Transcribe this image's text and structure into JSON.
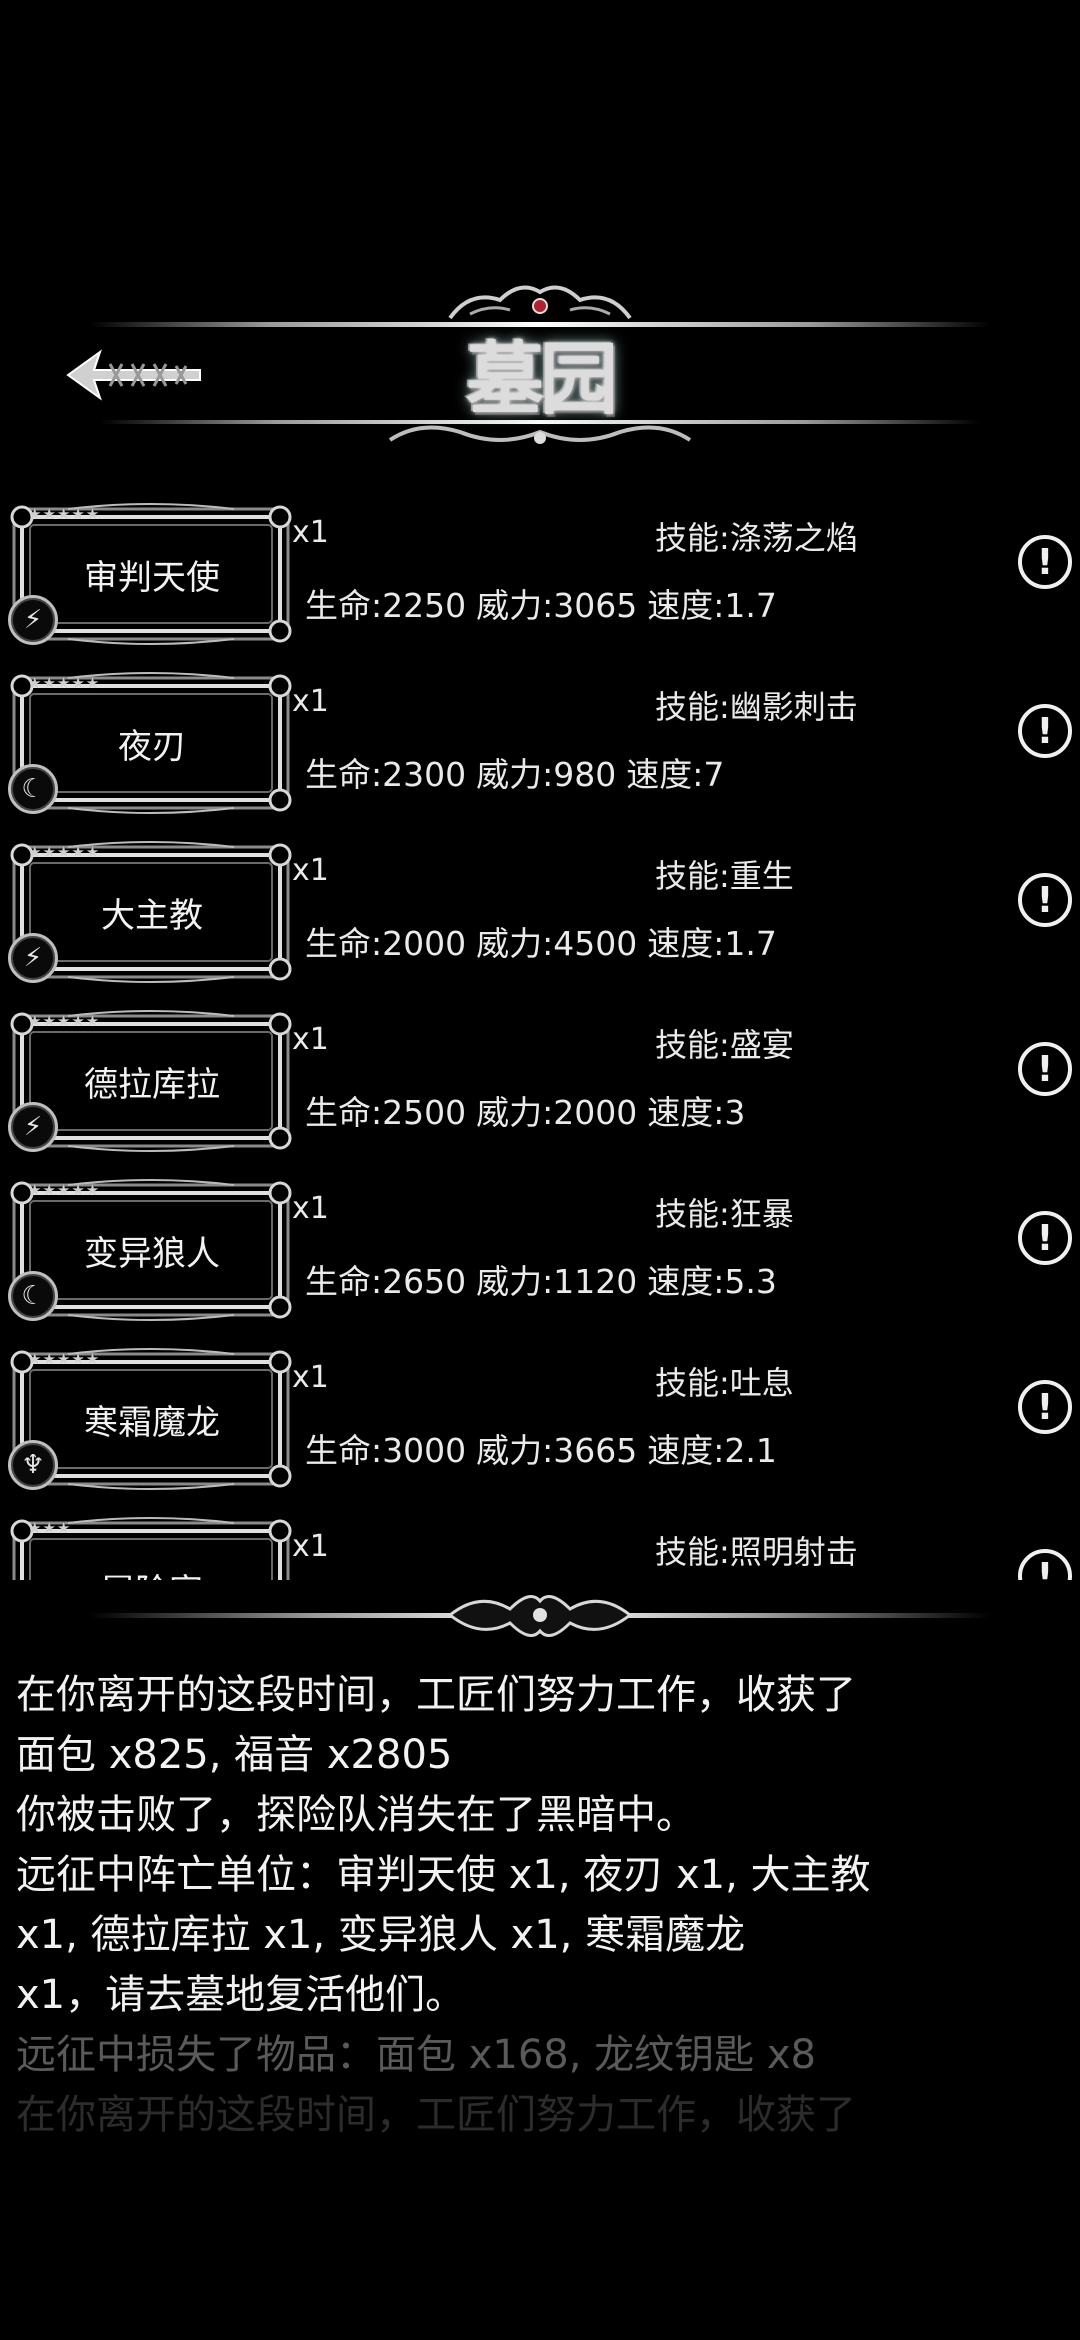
{
  "header": {
    "title": "墓园",
    "back_label": "返回"
  },
  "units": [
    {
      "name": "审判天使",
      "stars": "★★★★★",
      "type_icon": "lightning-icon",
      "type_glyph": "⚡",
      "qty": "x1",
      "skill": "技能:涤荡之焰",
      "hp": "生命:2250",
      "power": "威力:3065",
      "speed": "速度:1.7"
    },
    {
      "name": "夜刃",
      "stars": "★★★★★",
      "type_icon": "claw-icon",
      "type_glyph": "☾",
      "qty": "x1",
      "skill": "技能:幽影刺击",
      "hp": "生命:2300",
      "power": "威力:980",
      "speed": "速度:7"
    },
    {
      "name": "大主教",
      "stars": "★★★★★",
      "type_icon": "lightning-icon",
      "type_glyph": "⚡",
      "qty": "x1",
      "skill": "技能:重生",
      "hp": "生命:2000",
      "power": "威力:4500",
      "speed": "速度:1.7"
    },
    {
      "name": "德拉库拉",
      "stars": "★★★★★",
      "type_icon": "lightning-icon",
      "type_glyph": "⚡",
      "qty": "x1",
      "skill": "技能:盛宴",
      "hp": "生命:2500",
      "power": "威力:2000",
      "speed": "速度:3"
    },
    {
      "name": "变异狼人",
      "stars": "★★★★★",
      "type_icon": "claw-icon",
      "type_glyph": "☾",
      "qty": "x1",
      "skill": "技能:狂暴",
      "hp": "生命:2650",
      "power": "威力:1120",
      "speed": "速度:5.3"
    },
    {
      "name": "寒霜魔龙",
      "stars": "★★★★★",
      "type_icon": "bat-icon",
      "type_glyph": "♆",
      "qty": "x1",
      "skill": "技能:吐息",
      "hp": "生命:3000",
      "power": "威力:3665",
      "speed": "速度:2.1"
    },
    {
      "name": "冒险家",
      "stars": "★★★",
      "type_icon": "lightning-icon",
      "type_glyph": "⚡",
      "qty": "x1",
      "skill": "技能:照明射击",
      "hp": "",
      "power": "",
      "speed": ""
    }
  ],
  "log": [
    "在你离开的这段时间，工匠们努力工作，收获了",
    "面包 x825, 福音 x2805",
    "你被击败了，探险队消失在了黑暗中。",
    "远征中阵亡单位：审判天使 x1, 夜刃 x1, 大主教",
    "x1, 德拉库拉 x1, 变异狼人 x1, 寒霜魔龙",
    "x1，请去墓地复活他们。",
    "远征中损失了物品：面包 x168, 龙纹钥匙 x8",
    "在你离开的这段时间，工匠们努力工作，收获了"
  ],
  "info_glyph": "!"
}
